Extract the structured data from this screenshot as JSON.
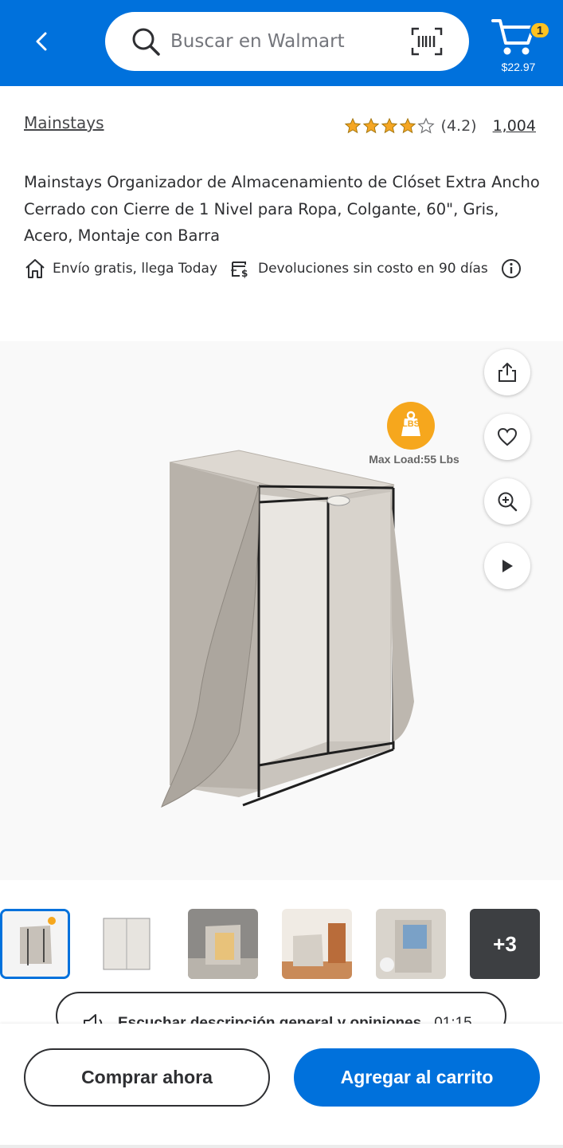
{
  "header": {
    "search_placeholder": "Buscar en Walmart",
    "cart_count": "1",
    "cart_total": "$22.97"
  },
  "product": {
    "brand": "Mainstays",
    "rating_text": "(4.2)",
    "rating_value": 4.2,
    "review_count": "1,004",
    "title": "Mainstays Organizador de Almacenamiento de Clóset Extra Ancho Cerrado con Cierre de 1 Nivel para Ropa, Colgante, 60\", Gris, Acero, Montaje con Barra",
    "shipping": "Envío gratis, llega Today",
    "returns": "Devoluciones sin costo en 90 días"
  },
  "image": {
    "badge_label": "LBS",
    "max_load": "Max Load:55 Lbs"
  },
  "thumbnails": {
    "more_count": "+3"
  },
  "listen": {
    "label": "Escuchar descripción general y opiniones",
    "duration": "01:15"
  },
  "actions": {
    "buy_now": "Comprar ahora",
    "add_to_cart": "Agregar al carrito"
  },
  "colors": {
    "brand_blue": "#0071dc",
    "spark_yellow": "#ffc220",
    "star_gold": "#f5a623"
  },
  "icons": [
    "back-arrow-icon",
    "search-icon",
    "barcode-icon",
    "cart-icon",
    "star-icon",
    "home-icon",
    "returns-icon",
    "info-icon",
    "share-icon",
    "heart-icon",
    "zoom-icon",
    "play-icon",
    "speaker-icon"
  ]
}
